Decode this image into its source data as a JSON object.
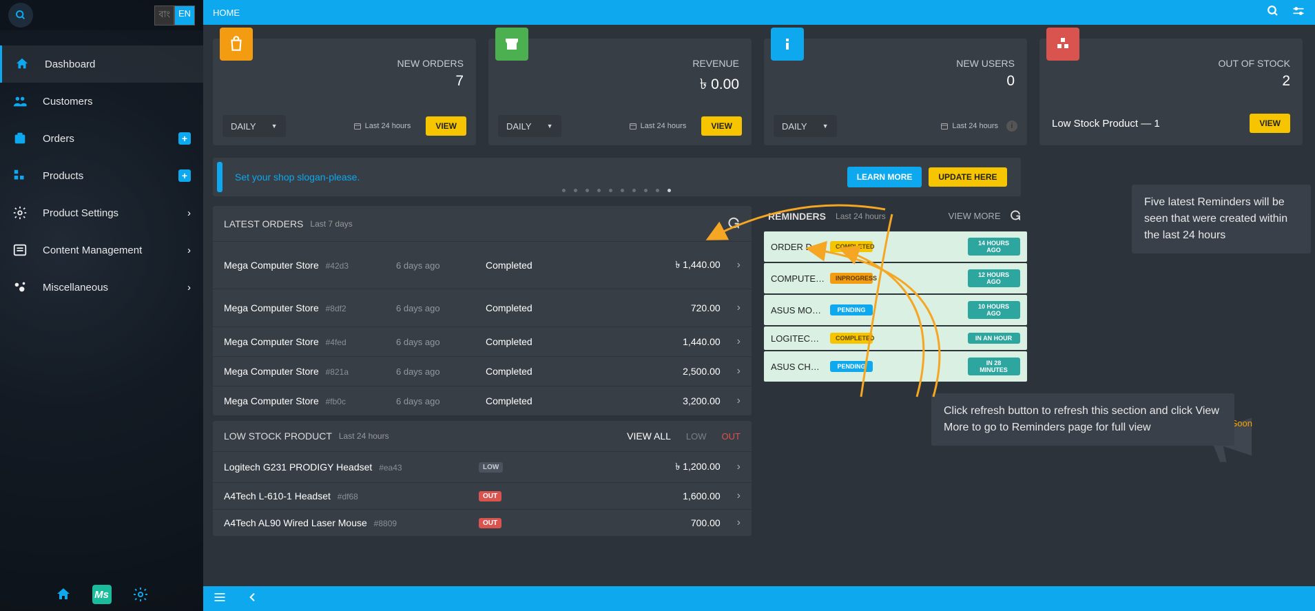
{
  "topbar": {
    "title": "HOME"
  },
  "lang": {
    "bn": "বাং",
    "en": "EN"
  },
  "nav": [
    {
      "id": "dashboard",
      "label": "Dashboard",
      "active": true
    },
    {
      "id": "customers",
      "label": "Customers"
    },
    {
      "id": "orders",
      "label": "Orders",
      "plus": true
    },
    {
      "id": "products",
      "label": "Products",
      "plus": true
    },
    {
      "id": "product-settings",
      "label": "Product Settings",
      "chev": true
    },
    {
      "id": "content-mgmt",
      "label": "Content Management",
      "chev": true
    },
    {
      "id": "misc",
      "label": "Miscellaneous",
      "chev": true
    }
  ],
  "cards": {
    "orders": {
      "label": "NEW ORDERS",
      "value": "7",
      "color": "#f39c12",
      "period": "DAILY",
      "range": "Last 24 hours",
      "btn": "VIEW"
    },
    "revenue": {
      "label": "REVENUE",
      "value": "৳   0.00",
      "color": "#4caf50",
      "period": "DAILY",
      "range": "Last 24 hours",
      "btn": "VIEW"
    },
    "users": {
      "label": "NEW USERS",
      "value": "0",
      "color": "#0da8ee",
      "period": "DAILY",
      "range": "Last 24 hours",
      "btn": "VIEW"
    },
    "stock": {
      "label": "OUT OF STOCK",
      "value": "2",
      "color": "#d9534f",
      "low_line": "Low Stock Product — 1",
      "btn": "VIEW"
    }
  },
  "slogan": {
    "text": "Set your shop slogan-please.",
    "learn": "LEARN MORE",
    "update": "UPDATE HERE"
  },
  "latest_orders": {
    "title": "LATEST ORDERS",
    "sub": "Last 7 days",
    "rows": [
      {
        "store": "Mega Computer Store",
        "code": "#42d3",
        "ago": "6 days ago",
        "status": "Completed",
        "amount": "৳  1,440.00"
      },
      {
        "store": "Mega Computer Store",
        "code": "#8df2",
        "ago": "6 days ago",
        "status": "Completed",
        "amount": "720.00"
      },
      {
        "store": "Mega Computer Store",
        "code": "#4fed",
        "ago": "6 days ago",
        "status": "Completed",
        "amount": "1,440.00"
      },
      {
        "store": "Mega Computer Store",
        "code": "#821a",
        "ago": "6 days ago",
        "status": "Completed",
        "amount": "2,500.00"
      },
      {
        "store": "Mega Computer Store",
        "code": "#fb0c",
        "ago": "6 days ago",
        "status": "Completed",
        "amount": "3,200.00"
      }
    ]
  },
  "low_stock": {
    "title": "LOW STOCK PRODUCT",
    "sub": "Last 24 hours",
    "viewall": "VIEW ALL",
    "low": "LOW",
    "out": "OUT",
    "rows": [
      {
        "prod": "Logitech G231 PRODIGY Headset",
        "code": "#ea43",
        "badge": "LOW",
        "amount": "৳  1,200.00"
      },
      {
        "prod": "A4Tech L-610-1 Headset",
        "code": "#df68",
        "badge": "OUT",
        "amount": "1,600.00"
      },
      {
        "prod": "A4Tech AL90 Wired Laser Mouse",
        "code": "#8809",
        "badge": "OUT",
        "amount": "700.00"
      }
    ]
  },
  "reminders": {
    "title": "REMINDERS",
    "sub": "Last 24 hours",
    "viewmore": "VIEW MORE",
    "rows": [
      {
        "title": "ORDER DUE F…",
        "status": "COMPLETED",
        "sclass": "p-comp",
        "time": "14 HOURS AGO"
      },
      {
        "title": "COMPUTER …",
        "status": "INPROGRESS",
        "sclass": "p-prog",
        "time": "12 HOURS AGO"
      },
      {
        "title": "ASUS MONIT…",
        "status": "PENDING",
        "sclass": "p-pend",
        "time": "10 HOURS AGO"
      },
      {
        "title": "LOGITECH KE…",
        "status": "COMPLETED",
        "sclass": "p-comp",
        "time": "IN AN HOUR"
      },
      {
        "title": "ASUS CHROM…",
        "status": "PENDING",
        "sclass": "p-pend",
        "time": "IN 28 MINUTES"
      }
    ]
  },
  "tips": {
    "t1": "Five latest Reminders will be seen that were created within the last 24 hours",
    "t2": "Click refresh button to refresh this section and click View More to go to Reminders page for full view"
  },
  "coming": "Coming Soon",
  "ms": "Ms"
}
